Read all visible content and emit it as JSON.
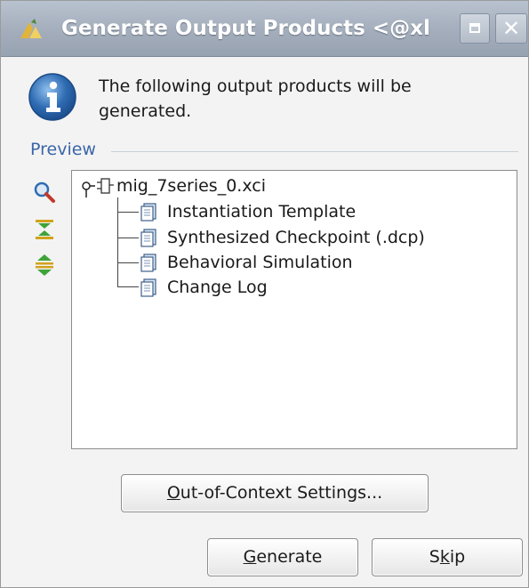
{
  "window": {
    "title": "Generate Output Products <@xl",
    "close_glyph": "✕",
    "icons": {
      "app": "vivado-logo-icon",
      "maximize": "maximize-icon",
      "close": "close-icon"
    }
  },
  "message": {
    "icon": "info-icon",
    "text": "The following output products will be generated."
  },
  "preview": {
    "label": "Preview",
    "tools": [
      "search-icon",
      "collapse-all-icon",
      "expand-all-icon"
    ],
    "tree": {
      "root": "mig_7series_0.xci",
      "children": [
        "Instantiation Template",
        "Synthesized Checkpoint (.dcp)",
        "Behavioral Simulation",
        "Change Log"
      ]
    }
  },
  "buttons": {
    "ooc": {
      "mnemonic": "O",
      "rest": "ut-of-Context Settings..."
    },
    "generate": {
      "mnemonic": "G",
      "rest": "enerate"
    },
    "skip": {
      "pre": "S",
      "mnemonic": "k",
      "rest": "ip"
    }
  },
  "colors": {
    "titlebar": "#a3adbb",
    "accent": "#3a66a8",
    "info_blue": "#2f6cb3"
  }
}
